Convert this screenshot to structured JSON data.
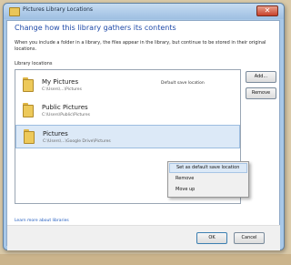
{
  "window": {
    "title": "Pictures Library Locations",
    "close_icon": "close-icon"
  },
  "dialog": {
    "heading": "Change how this library gathers its contents",
    "description": "When you include a folder in a library, the files appear in the library, but continue to be stored in their original locations.",
    "section_label": "Library locations"
  },
  "library": {
    "items": [
      {
        "name": "My Pictures",
        "path": "C:\\Users\\...\\Pictures",
        "tag": "Default save location",
        "icon": "folder-icon"
      },
      {
        "name": "Public Pictures",
        "path": "C:\\Users\\Public\\Pictures",
        "tag": "",
        "icon": "folder-icon"
      },
      {
        "name": "Pictures",
        "path": "C:\\Users\\...\\Google Drive\\Pictures",
        "tag": "",
        "icon": "folder-icon",
        "selected": true
      }
    ]
  },
  "buttons": {
    "add": "Add...",
    "remove": "Remove",
    "ok": "OK",
    "cancel": "Cancel"
  },
  "context_menu": {
    "items": [
      "Set as default save location",
      "Remove",
      "Move up"
    ]
  },
  "footer": {
    "link": "Learn more about libraries"
  },
  "colors": {
    "heading": "#1f4aa8",
    "selection": "#dce9f7",
    "link": "#1f5bbf",
    "titlebar": "#a8c8e8"
  }
}
